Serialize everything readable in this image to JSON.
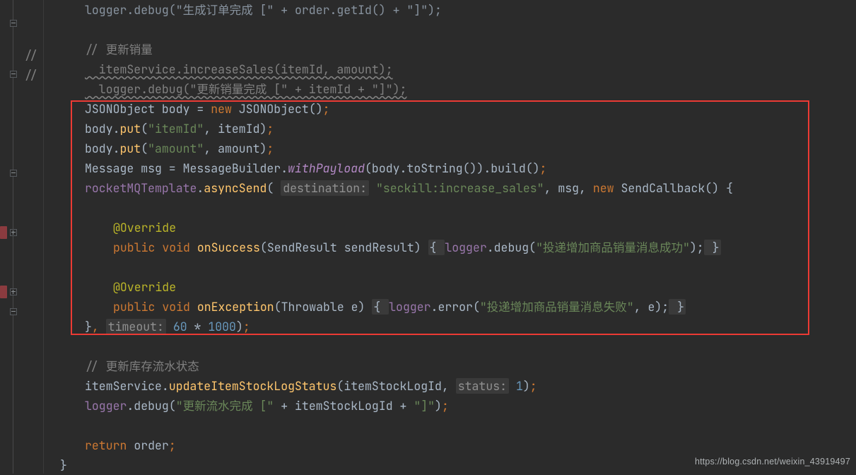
{
  "gutter": {
    "slash1": "//",
    "slash2": "//"
  },
  "l0": "logger.debug(\"生成订单完成 [\" + order.getId() + \"]\");",
  "l2c": "// 更新销量",
  "l3": "  itemService.increaseSales(itemId, amount);",
  "l4": "  logger.debug(\"更新销量完成 [\" + itemId + \"]\");",
  "l5_a": "JSONObject",
  "l5_b": " body = ",
  "l5_new": "new ",
  "l5_c": "JSONObject",
  "l5_d": "()",
  "l5_s": ";",
  "l6_a": "body.",
  "l6_m": "put",
  "l6_b": "(",
  "l6_str": "\"itemId\"",
  "l6_c": ", itemId)",
  "l6_s": ";",
  "l7_a": "body.",
  "l7_m": "put",
  "l7_b": "(",
  "l7_str": "\"amount\"",
  "l7_c": ", amount)",
  "l7_s": ";",
  "l8_a": "Message",
  "l8_b": " msg = MessageBuilder.",
  "l8_m": "withPayload",
  "l8_c": "(body.toString()).build()",
  "l8_s": ";",
  "l9_a": "rocketMQTemplate",
  "l9_dot": ".",
  "l9_m": "asyncSend",
  "l9_b": "( ",
  "l9_p1": "destination:",
  "l9_sp1": " ",
  "l9_str": "\"seckill:increase_sales\"",
  "l9_c": ", msg, ",
  "l9_new": "new ",
  "l9_d": "SendCallback",
  "l9_e": "() {",
  "l11_anno": "@Override",
  "l12_kw1": "public ",
  "l12_kw2": "void ",
  "l12_m": "onSuccess",
  "l12_b": "(SendResult sendResult) ",
  "l12_fold_o": "{ ",
  "l12_log": "logger",
  "l12_dbg": ".debug(",
  "l12_str": "\"投递增加商品销量消息成功\"",
  "l12_end": ");",
  "l12_fold_c": " }",
  "l14_anno": "@Override",
  "l15_kw1": "public ",
  "l15_kw2": "void ",
  "l15_m": "onException",
  "l15_b": "(Throwable e) ",
  "l15_fold_o": "{ ",
  "l15_log": "logger",
  "l15_err": ".error(",
  "l15_str": "\"投递增加商品销量消息失败\"",
  "l15_c": ", e);",
  "l15_fold_c": " }",
  "l16_a": "}",
  "l16_b": ", ",
  "l16_p": "timeout:",
  "l16_sp": " ",
  "l16_n1": "60",
  "l16_op": " * ",
  "l16_n2": "1000",
  "l16_c": ")",
  "l16_s": ";",
  "l18c": "// 更新库存流水状态",
  "l19_a": "itemService.",
  "l19_m": "updateItemStockLogStatus",
  "l19_b": "(itemStockLogId, ",
  "l19_p": "status:",
  "l19_sp": " ",
  "l19_n": "1",
  "l19_c": ")",
  "l19_s": ";",
  "l20_a": "logger",
  "l20_b": ".debug(",
  "l20_s1": "\"更新流水完成 [\"",
  "l20_c": " + itemStockLogId + ",
  "l20_s2": "\"]\"",
  "l20_d": ")",
  "l20_s": ";",
  "l22_kw": "return ",
  "l22_b": "order",
  "l22_s": ";",
  "l23": "}",
  "watermark": "https://blog.csdn.net/weixin_43919497"
}
